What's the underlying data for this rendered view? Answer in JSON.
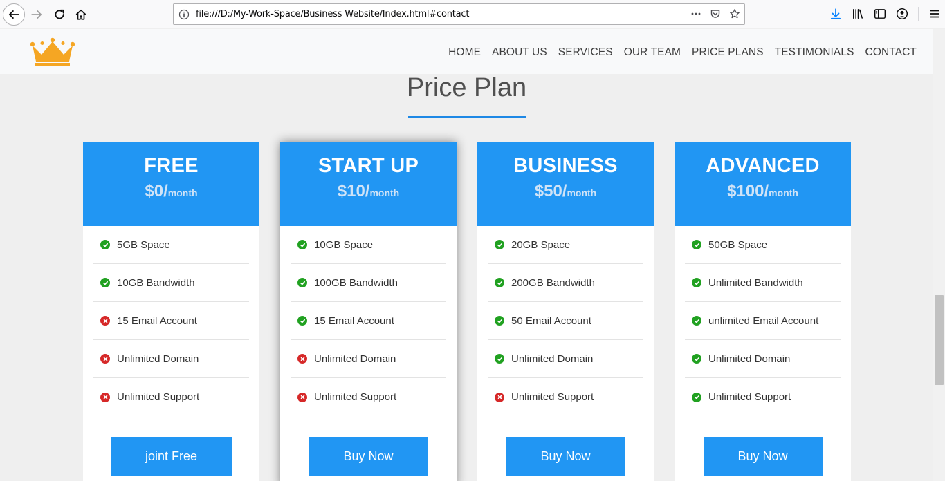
{
  "browser": {
    "url": "file:///D:/My-Work-Space/Business Website/Index.html#contact"
  },
  "nav": {
    "items": [
      "HOME",
      "ABOUT US",
      "SERVICES",
      "OUR TEAM",
      "PRICE PLANS",
      "TESTIMONIALS",
      "CONTACT"
    ]
  },
  "section": {
    "title": "Price Plan"
  },
  "plans": [
    {
      "name": "FREE",
      "price": "$0/",
      "per": "month",
      "features": [
        {
          "text": "5GB Space",
          "included": true
        },
        {
          "text": "10GB Bandwidth",
          "included": true
        },
        {
          "text": "15 Email Account",
          "included": false
        },
        {
          "text": "Unlimited Domain",
          "included": false
        },
        {
          "text": "Unlimited Support",
          "included": false
        }
      ],
      "button": "joint Free"
    },
    {
      "name": "START UP",
      "price": "$10/",
      "per": "month",
      "features": [
        {
          "text": "10GB Space",
          "included": true
        },
        {
          "text": "100GB Bandwidth",
          "included": true
        },
        {
          "text": "15 Email Account",
          "included": true
        },
        {
          "text": "Unlimited Domain",
          "included": false
        },
        {
          "text": "Unlimited Support",
          "included": false
        }
      ],
      "button": "Buy Now"
    },
    {
      "name": "BUSINESS",
      "price": "$50/",
      "per": "month",
      "features": [
        {
          "text": "20GB Space",
          "included": true
        },
        {
          "text": "200GB Bandwidth",
          "included": true
        },
        {
          "text": "50 Email Account",
          "included": true
        },
        {
          "text": "Unlimited Domain",
          "included": true
        },
        {
          "text": "Unlimited Support",
          "included": false
        }
      ],
      "button": "Buy Now"
    },
    {
      "name": "ADVANCED",
      "price": "$100/",
      "per": "month",
      "features": [
        {
          "text": "50GB Space",
          "included": true
        },
        {
          "text": "Unlimited Bandwidth",
          "included": true
        },
        {
          "text": "unlimited Email Account",
          "included": true
        },
        {
          "text": "Unlimited Domain",
          "included": true
        },
        {
          "text": "Unlimited Support",
          "included": true
        }
      ],
      "button": "Buy Now"
    }
  ],
  "colors": {
    "accent": "#2196f3",
    "check": "#21a121",
    "cross": "#d62828",
    "logo": "#f5a623"
  }
}
